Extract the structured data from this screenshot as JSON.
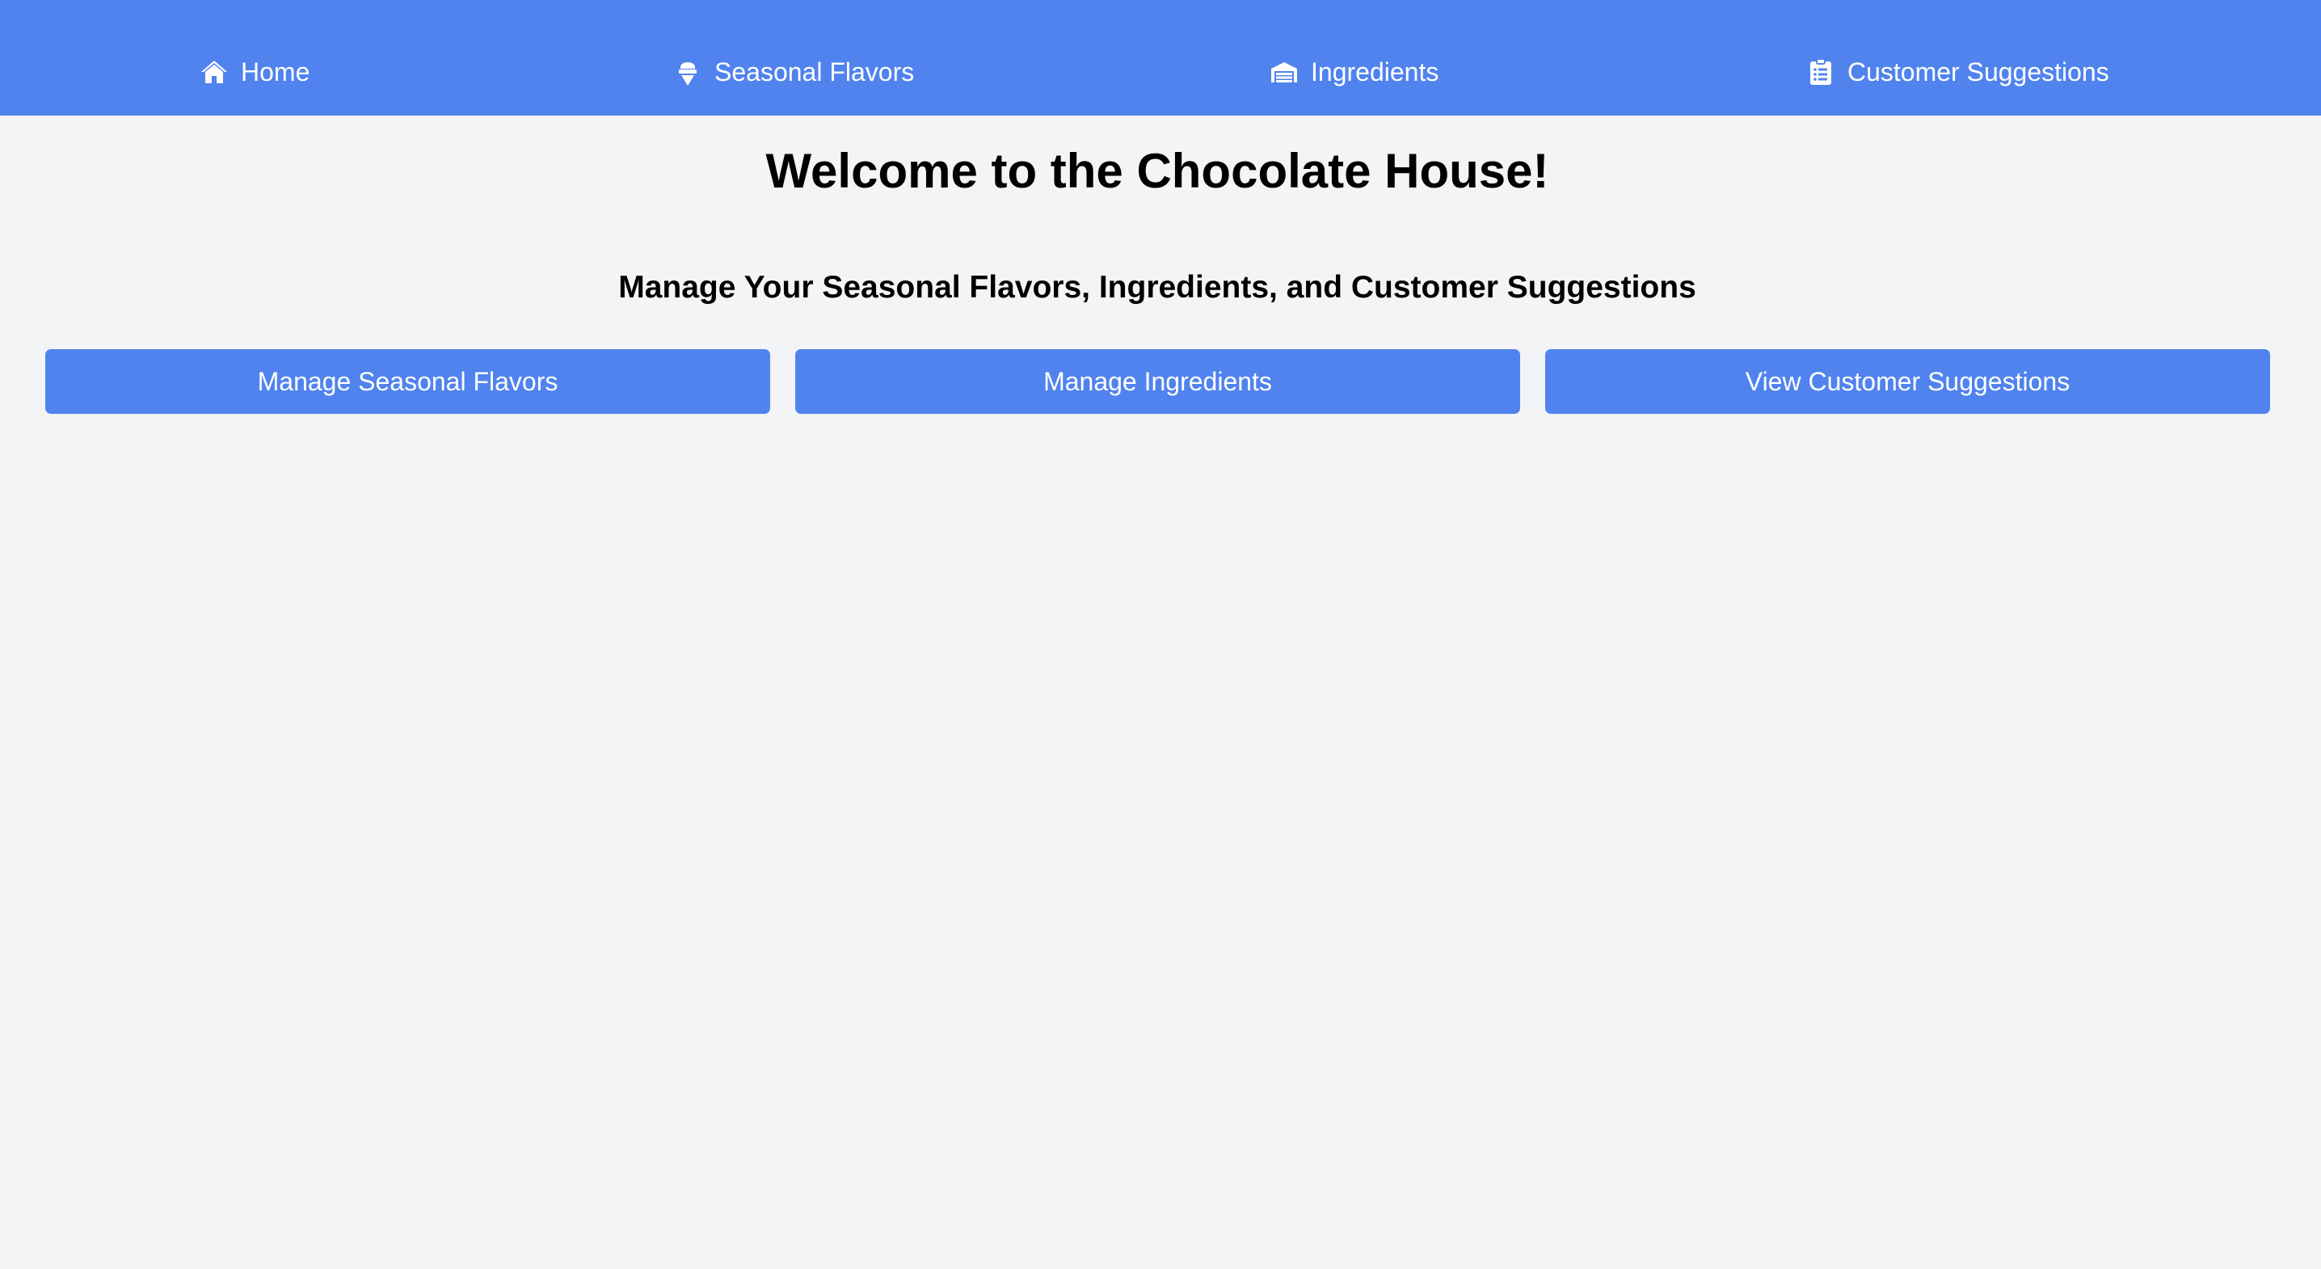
{
  "nav": {
    "items": [
      {
        "label": "Home",
        "icon": "home-icon"
      },
      {
        "label": "Seasonal Flavors",
        "icon": "ice-cream-icon"
      },
      {
        "label": "Ingredients",
        "icon": "warehouse-icon"
      },
      {
        "label": "Customer Suggestions",
        "icon": "clipboard-list-icon"
      }
    ]
  },
  "main": {
    "title": "Welcome to the Chocolate House!",
    "subtitle": "Manage Your Seasonal Flavors, Ingredients, and Customer Suggestions",
    "buttons": [
      {
        "label": "Manage Seasonal Flavors"
      },
      {
        "label": "Manage Ingredients"
      },
      {
        "label": "View Customer Suggestions"
      }
    ]
  },
  "colors": {
    "primary": "#5083ee",
    "background": "#f3f4f6",
    "text": "#000000",
    "on_primary": "#ffffff"
  }
}
